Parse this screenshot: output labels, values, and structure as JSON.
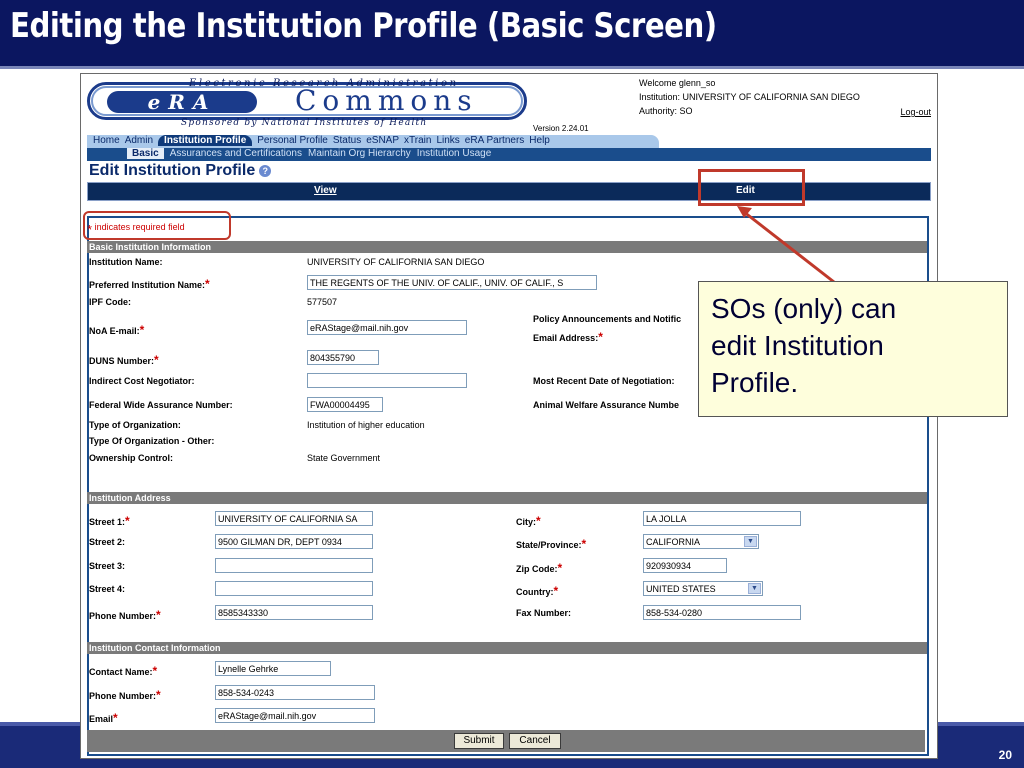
{
  "slide": {
    "title": "Editing the Institution Profile (Basic Screen)",
    "page_number": "20"
  },
  "header": {
    "era_line": "Electronic Research Administration",
    "era_logo": "eRA",
    "commons": "Commons",
    "sponsor": "Sponsored by National Institutes of Health",
    "version": "Version 2.24.01",
    "welcome": "Welcome  glenn_so",
    "institution": "Institution: UNIVERSITY OF CALIFORNIA SAN DIEGO",
    "authority": "Authority:   SO",
    "logout": "Log-out"
  },
  "nav": {
    "main": [
      "Home",
      "Admin",
      "Institution Profile",
      "Personal Profile",
      "Status",
      "eSNAP",
      "xTrain",
      "Links",
      "eRA Partners",
      "Help"
    ],
    "sub": [
      "Basic",
      "Assurances and Certifications",
      "Maintain Org Hierarchy",
      "Institution Usage"
    ]
  },
  "page_title": "Edit Institution Profile",
  "help_icon": "?",
  "tabs": {
    "view": "View",
    "edit": "Edit"
  },
  "required_note": "indicates required field",
  "required_star": "*",
  "basic": {
    "heading": "Basic Institution Information",
    "institution_name_label": "Institution Name:",
    "institution_name": "UNIVERSITY OF CALIFORNIA SAN DIEGO",
    "preferred_name_label": "Preferred Institution Name:",
    "preferred_name": "THE REGENTS OF THE UNIV. OF CALIF., UNIV. OF CALIF., S",
    "ipf_label": "IPF Code:",
    "ipf": "577507",
    "noa_label": "NoA E-mail:",
    "noa": "eRAStage@mail.nih.gov",
    "policy_label_1": "Policy Announcements and Notific",
    "policy_label_2": "Email Address:",
    "duns_label": "DUNS Number:",
    "duns": "804355790",
    "indirect_label": "Indirect Cost Negotiator:",
    "indirect": "",
    "recent_label": "Most Recent Date of Negotiation:",
    "fwa_label": "Federal Wide Assurance Number:",
    "fwa": "FWA00004495",
    "animal_label": "Animal Welfare Assurance Numbe",
    "org_type_label": "Type of Organization:",
    "org_type": "Institution of higher education",
    "org_other_label": "Type Of Organization - Other:",
    "ownership_label": "Ownership Control:",
    "ownership": "State Government"
  },
  "address": {
    "heading": "Institution Address",
    "street1_label": "Street 1:",
    "street1": "UNIVERSITY OF CALIFORNIA SA",
    "street2_label": "Street 2:",
    "street2": "9500 GILMAN DR, DEPT 0934",
    "street3_label": "Street 3:",
    "street3": "",
    "street4_label": "Street 4:",
    "street4": "",
    "phone_label": "Phone Number:",
    "phone": "8585343330",
    "city_label": "City:",
    "city": "LA JOLLA",
    "state_label": "State/Province:",
    "state": "CALIFORNIA",
    "zip_label": "Zip Code:",
    "zip": "920930934",
    "country_label": "Country:",
    "country": "UNITED STATES",
    "fax_label": "Fax Number:",
    "fax": "858-534-0280"
  },
  "contact": {
    "heading": "Institution Contact Information",
    "name_label": "Contact Name:",
    "name": "Lynelle Gehrke",
    "phone_label": "Phone Number:",
    "phone": "858-534-0243",
    "email_label": "Email",
    "email": "eRAStage@mail.nih.gov"
  },
  "buttons": {
    "submit": "Submit",
    "cancel": "Cancel"
  },
  "callout": {
    "line1": "SOs (only) can",
    "line2": "edit Institution",
    "line3": "Profile."
  },
  "colors": {
    "slide_header": "#0b1660",
    "annotation_red": "#c0392b",
    "callout_bg": "#fefedc"
  }
}
